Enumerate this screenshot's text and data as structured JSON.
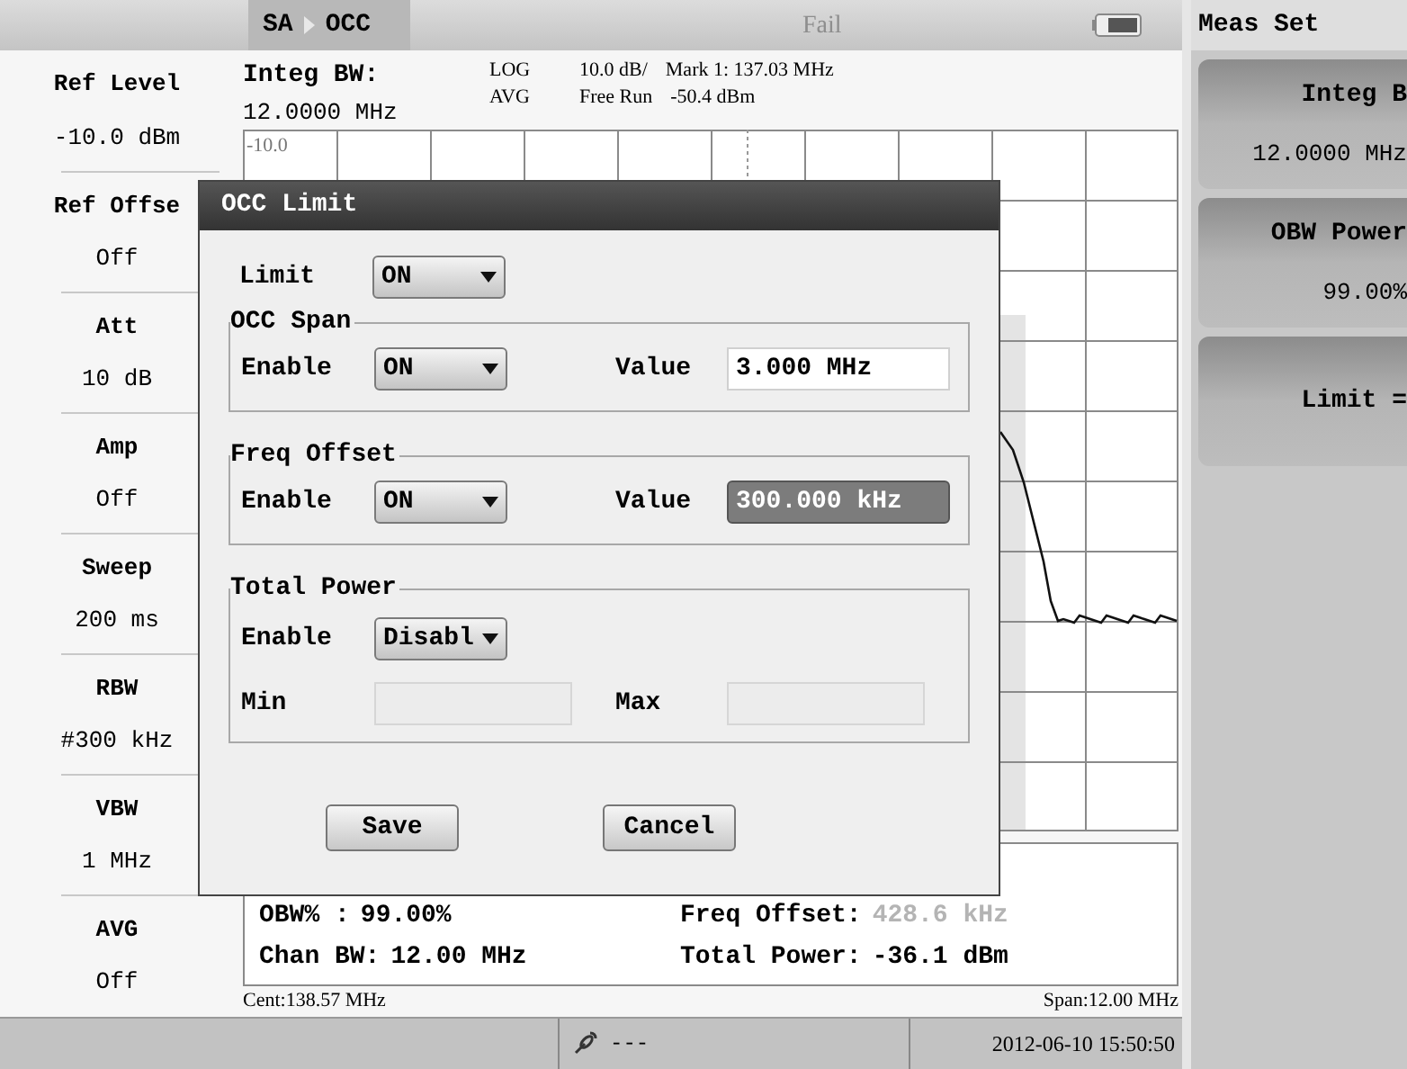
{
  "top_bar": {
    "breadcrumb": [
      "SA",
      "OCC"
    ],
    "status": "Fail"
  },
  "soft_keys": [
    {
      "label": "Ref Level",
      "value": "-10.0 dBm"
    },
    {
      "label": "Ref Offse",
      "value": "Off"
    },
    {
      "label": "Att",
      "value": "10 dB"
    },
    {
      "label": "Amp",
      "value": "Off"
    },
    {
      "label": "Sweep",
      "value": "200 ms"
    },
    {
      "label": "RBW",
      "value": "#300 kHz"
    },
    {
      "label": "VBW",
      "value": "1 MHz"
    },
    {
      "label": "AVG",
      "value": "Off"
    }
  ],
  "trace_header": {
    "integ_label": "Integ BW:",
    "integ_value": "12.0000 MHz",
    "scale_type": "LOG",
    "detector": "AVG",
    "scale": "10.0 dB/",
    "marker": "Mark 1: 137.03 MHz",
    "trigger": "Free Run",
    "marker_level": "-50.4 dBm"
  },
  "graph": {
    "ref_label": "-10.0"
  },
  "results": [
    {
      "label": "OBW% :",
      "value": "99.00%",
      "dimmed": false
    },
    {
      "label": "Freq Offset:",
      "value": "428.6 kHz",
      "dimmed": true
    },
    {
      "label": "Chan BW:",
      "value": "12.00 MHz",
      "dimmed": false
    },
    {
      "label": "Total Power:",
      "value": "-36.1 dBm",
      "dimmed": false
    }
  ],
  "footer": {
    "center": "Cent:138.57 MHz",
    "span": "Span:12.00 MHz"
  },
  "status_bar": {
    "gps": "---",
    "datetime": "2012-06-10 15:50:50"
  },
  "right_panel": {
    "title": "Meas Set",
    "keys": [
      {
        "label": "Integ B",
        "value": "12.0000 MHz"
      },
      {
        "label": "OBW Power",
        "value": "99.00%"
      },
      {
        "label": "Limit ="
      }
    ]
  },
  "dialog": {
    "title": "OCC Limit",
    "limit_label": "Limit",
    "limit_value": "ON",
    "groups": [
      {
        "title": "OCC Span",
        "kind": "value",
        "enable_label": "Enable",
        "enable_value": "ON",
        "value_label": "Value",
        "value": "3.000 MHz",
        "highlighted": false
      },
      {
        "title": "Freq Offset",
        "kind": "value",
        "enable_label": "Enable",
        "enable_value": "ON",
        "value_label": "Value",
        "value": "300.000 kHz",
        "highlighted": true
      },
      {
        "title": "Total Power",
        "kind": "range",
        "enable_label": "Enable",
        "enable_value": "Disabl",
        "min_label": "Min",
        "max_label": "Max"
      }
    ],
    "buttons": [
      "Save",
      "Cancel"
    ]
  }
}
